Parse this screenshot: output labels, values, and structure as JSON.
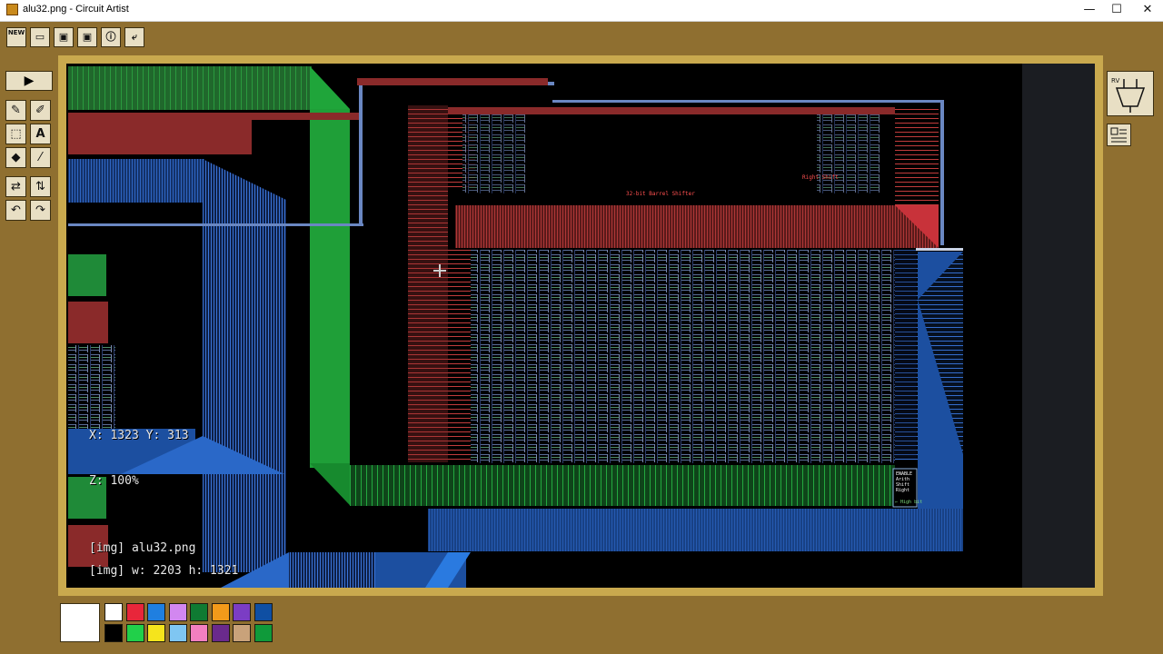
{
  "window": {
    "title": "alu32.png - Circuit Artist",
    "minimize": "—",
    "maximize": "☐",
    "close": "✕"
  },
  "toolbar": {
    "new_label": "NEW",
    "buttons": [
      "new-button",
      "open-button",
      "save-button",
      "save-as-button",
      "info-button",
      "exit-button"
    ]
  },
  "tools": {
    "play_glyph": "▶",
    "pencil": "✎",
    "line": "✐",
    "select": "⬚",
    "text": "A",
    "fill": "◆",
    "picker": "⁄",
    "flip_h": "⇄",
    "flip_v": "⇅",
    "rotate_l": "↶",
    "rotate_r": "↷"
  },
  "canvas": {
    "coords": "X: 1323 Y: 313",
    "zoom": "Z: 100%",
    "img_name": "[img] alu32.png",
    "img_size": "[img] w: 2203 h: 1321",
    "shifter_label": "32-bit Barrel Shifter",
    "right_shift_label": "Right Shift",
    "enable_label": "ENABLE\nArith\nShift\nRight",
    "high_bit_label": "← High bit"
  },
  "palette": {
    "selected_color": "#ffffff",
    "colors": [
      "#ffffff",
      "#e8263a",
      "#1f7fe0",
      "#d287f0",
      "#0f7a32",
      "#f29a1a",
      "#7b3dc4",
      "#0f4fa3",
      "#000000",
      "#21d04a",
      "#f5e41c",
      "#7fc6f2",
      "#f27fc0",
      "#6a2a8c",
      "#c9a27a",
      "#0f9a3a"
    ]
  },
  "theme": {
    "frame": "#8f6f30",
    "canvas_border": "#c9a94e",
    "wire_green": "#22b33a",
    "wire_red": "#8e2a2a",
    "wire_blue": "#1d4fa0"
  }
}
